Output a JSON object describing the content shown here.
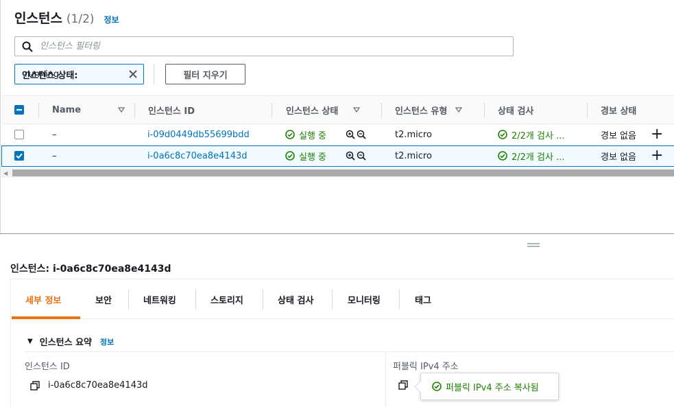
{
  "header": {
    "title": "인스턴스",
    "count": "(1/2)",
    "info": "정보"
  },
  "search": {
    "placeholder": "인스턴스 필터링"
  },
  "filter_token": {
    "key": "인스턴스 상태:",
    "value": "running"
  },
  "clear_filters": "필터 지우기",
  "columns": [
    "Name",
    "인스턴스 ID",
    "인스턴스 상태",
    "인스턴스 유형",
    "상태 검사",
    "경보 상태"
  ],
  "rows": [
    {
      "name": "–",
      "id": "i-09d0449db55699bdd",
      "state": "실행 중",
      "type": "t2.micro",
      "check": "2/2개 검사 ...",
      "alarm": "경보 없음",
      "selected": false
    },
    {
      "name": "–",
      "id": "i-0a6c8c70ea8e4143d",
      "state": "실행 중",
      "type": "t2.micro",
      "check": "2/2개 검사 ...",
      "alarm": "경보 없음",
      "selected": true
    }
  ],
  "detail": {
    "title": "인스턴스: i-0a6c8c70ea8e4143d",
    "tabs": [
      "세부 정보",
      "보안",
      "네트워킹",
      "스토리지",
      "상태 검사",
      "모니터링",
      "태그"
    ],
    "active_tab": "세부 정보",
    "summary_title": "인스턴스 요약",
    "summary_info": "정보",
    "instance_id_label": "인스턴스 ID",
    "instance_id_value": "i-0a6c8c70ea8e4143d",
    "public_ip_label": "퍼블릭 IPv4 주소",
    "toast": "퍼블릭 IPv4 주소 복사됨"
  },
  "colors": {
    "link": "#0073bb",
    "success": "#1d8102",
    "accent": "#ec7211"
  }
}
